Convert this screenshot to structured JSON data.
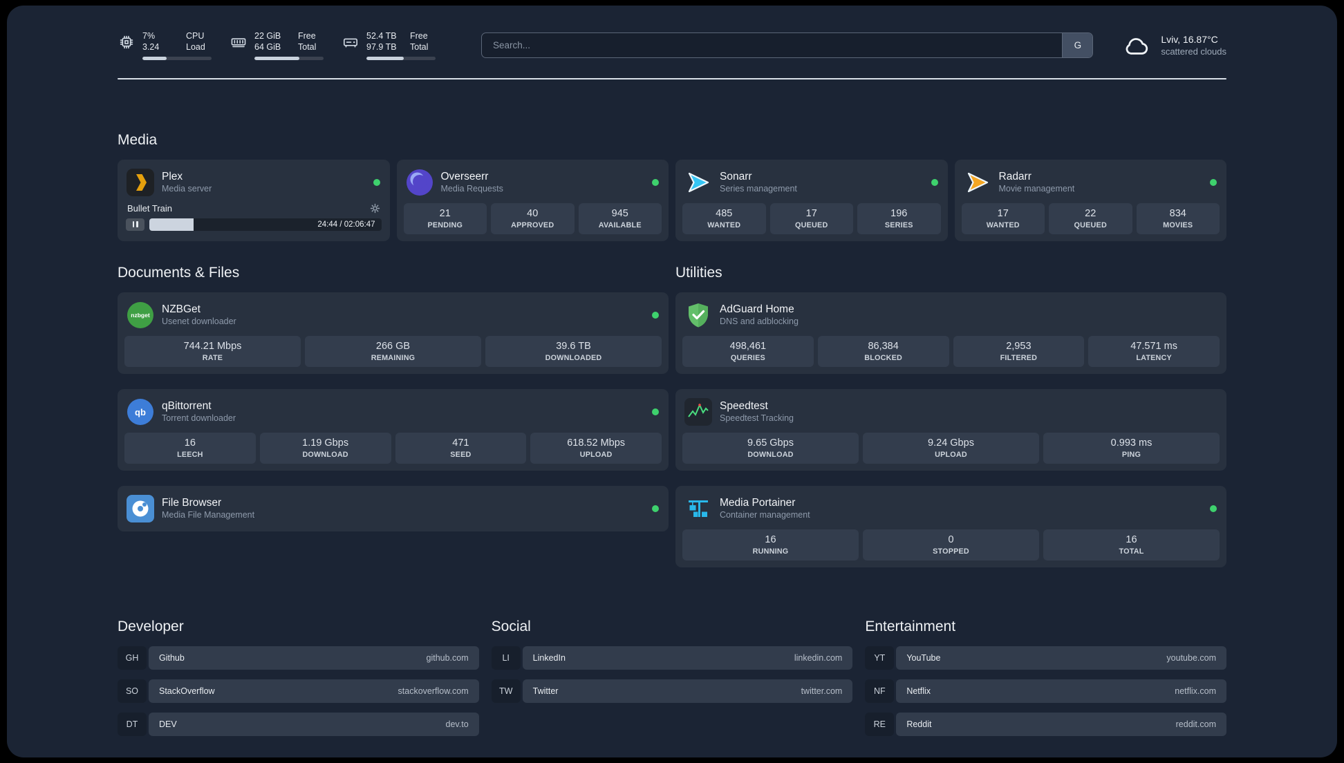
{
  "topbar": {
    "cpu": {
      "usage": "7%",
      "load": "3.24",
      "labels": [
        "CPU",
        "Load"
      ],
      "bar_percent": 35
    },
    "memory": {
      "free": "22 GiB",
      "total": "64 GiB",
      "labels": [
        "Free",
        "Total"
      ],
      "bar_percent": 65
    },
    "disk": {
      "free": "52.4 TB",
      "total": "97.9 TB",
      "labels": [
        "Free",
        "Total"
      ],
      "bar_percent": 54
    },
    "search": {
      "placeholder": "Search...",
      "provider_button": "G"
    },
    "weather": {
      "location_temp": "Lviv, 16.87°C",
      "condition": "scattered clouds"
    }
  },
  "media": {
    "title": "Media",
    "plex": {
      "name": "Plex",
      "desc": "Media server",
      "player": {
        "track_title": "Bullet Train",
        "time": "24:44 / 02:06:47",
        "progress_percent": 19
      }
    },
    "cards": [
      {
        "name": "Overseerr",
        "desc": "Media Requests",
        "stats": [
          {
            "value": "21",
            "label": "PENDING"
          },
          {
            "value": "40",
            "label": "APPROVED"
          },
          {
            "value": "945",
            "label": "AVAILABLE"
          }
        ]
      },
      {
        "name": "Sonarr",
        "desc": "Series management",
        "stats": [
          {
            "value": "485",
            "label": "WANTED"
          },
          {
            "value": "17",
            "label": "QUEUED"
          },
          {
            "value": "196",
            "label": "SERIES"
          }
        ]
      },
      {
        "name": "Radarr",
        "desc": "Movie management",
        "stats": [
          {
            "value": "17",
            "label": "WANTED"
          },
          {
            "value": "22",
            "label": "QUEUED"
          },
          {
            "value": "834",
            "label": "MOVIES"
          }
        ]
      }
    ]
  },
  "documents": {
    "title": "Documents & Files",
    "cards": [
      {
        "name": "NZBGet",
        "desc": "Usenet downloader",
        "stats": [
          {
            "value": "744.21 Mbps",
            "label": "RATE"
          },
          {
            "value": "266 GB",
            "label": "REMAINING"
          },
          {
            "value": "39.6 TB",
            "label": "DOWNLOADED"
          }
        ]
      },
      {
        "name": "qBittorrent",
        "desc": "Torrent downloader",
        "stats": [
          {
            "value": "16",
            "label": "LEECH"
          },
          {
            "value": "1.19 Gbps",
            "label": "DOWNLOAD"
          },
          {
            "value": "471",
            "label": "SEED"
          },
          {
            "value": "618.52 Mbps",
            "label": "UPLOAD"
          }
        ]
      },
      {
        "name": "File Browser",
        "desc": "Media File Management",
        "stats": []
      }
    ]
  },
  "utilities": {
    "title": "Utilities",
    "cards": [
      {
        "name": "AdGuard Home",
        "desc": "DNS and adblocking",
        "stats": [
          {
            "value": "498,461",
            "label": "QUERIES"
          },
          {
            "value": "86,384",
            "label": "BLOCKED"
          },
          {
            "value": "2,953",
            "label": "FILTERED"
          },
          {
            "value": "47.571 ms",
            "label": "LATENCY"
          }
        ]
      },
      {
        "name": "Speedtest",
        "desc": "Speedtest Tracking",
        "stats": [
          {
            "value": "9.65 Gbps",
            "label": "DOWNLOAD"
          },
          {
            "value": "9.24 Gbps",
            "label": "UPLOAD"
          },
          {
            "value": "0.993 ms",
            "label": "PING"
          }
        ]
      },
      {
        "name": "Media Portainer",
        "desc": "Container management",
        "stats": [
          {
            "value": "16",
            "label": "RUNNING"
          },
          {
            "value": "0",
            "label": "STOPPED"
          },
          {
            "value": "16",
            "label": "TOTAL"
          }
        ]
      }
    ]
  },
  "bookmarks": {
    "groups": [
      {
        "title": "Developer",
        "items": [
          {
            "abbr": "GH",
            "name": "Github",
            "url": "github.com"
          },
          {
            "abbr": "SO",
            "name": "StackOverflow",
            "url": "stackoverflow.com"
          },
          {
            "abbr": "DT",
            "name": "DEV",
            "url": "dev.to"
          }
        ]
      },
      {
        "title": "Social",
        "items": [
          {
            "abbr": "LI",
            "name": "LinkedIn",
            "url": "linkedin.com"
          },
          {
            "abbr": "TW",
            "name": "Twitter",
            "url": "twitter.com"
          }
        ]
      },
      {
        "title": "Entertainment",
        "items": [
          {
            "abbr": "YT",
            "name": "YouTube",
            "url": "youtube.com"
          },
          {
            "abbr": "NF",
            "name": "Netflix",
            "url": "netflix.com"
          },
          {
            "abbr": "RE",
            "name": "Reddit",
            "url": "reddit.com"
          }
        ]
      }
    ]
  },
  "icons": {
    "nzbget_text": "nzbget",
    "qbittorrent_text": "qb"
  },
  "colors": {
    "background": "#1b2434",
    "card": "#28313f",
    "stat_box": "#333d4d",
    "status_online": "#3ed16d",
    "divider": "#d9e0e8",
    "plex_gold": "#e5a00d",
    "overseerr_purple": "#5345c9",
    "sonarr_blue": "#35c5f4",
    "radarr_gold": "#f5a623",
    "nzbget_green": "#3f9f44",
    "qbittorrent_blue": "#3d7dd8",
    "filebrowser_blue": "#4a8fd4",
    "adguard_green": "#63bf6a",
    "speedtest_green": "#4ade80",
    "portainer_blue": "#29b8ea"
  }
}
